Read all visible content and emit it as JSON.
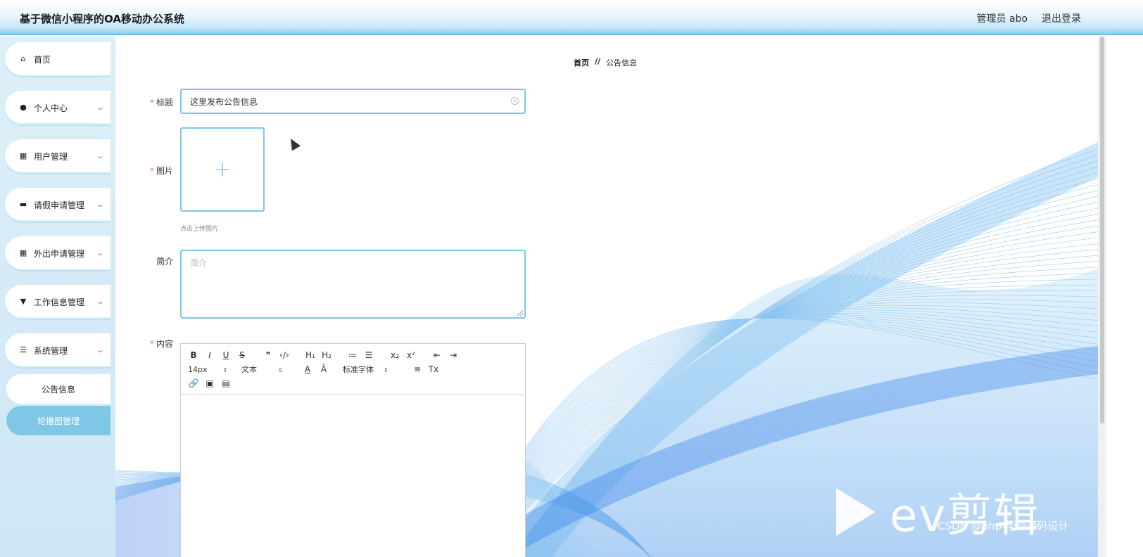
{
  "header": {
    "app_title": "基于微信小程序的OA移动办公系统",
    "admin_label": "管理员 abo",
    "logout_label": "退出登录"
  },
  "sidebar": {
    "items": [
      {
        "label": "首页",
        "icon": "home-icon",
        "has_submenu": false
      },
      {
        "label": "个人中心",
        "icon": "user-icon",
        "has_submenu": true
      },
      {
        "label": "用户管理",
        "icon": "grid-icon",
        "has_submenu": true
      },
      {
        "label": "请假申请管理",
        "icon": "ticket-icon",
        "has_submenu": true
      },
      {
        "label": "外出申请管理",
        "icon": "grid-icon",
        "has_submenu": true
      },
      {
        "label": "工作信息管理",
        "icon": "pin-icon",
        "has_submenu": true
      },
      {
        "label": "系统管理",
        "icon": "list-icon",
        "has_submenu": true
      }
    ],
    "sub_items": [
      {
        "label": "公告信息",
        "active": false
      },
      {
        "label": "轮播图管理",
        "active": true
      }
    ]
  },
  "breadcrumb": {
    "home": "首页",
    "separator": "//",
    "current": "公告信息"
  },
  "form": {
    "title_label": "标题",
    "title_value": "这里发布公告信息",
    "image_label": "图片",
    "upload_hint": "点击上传图片",
    "intro_label": "简介",
    "intro_placeholder": "简介",
    "content_label": "内容"
  },
  "editor": {
    "font_size": "14px",
    "block_type": "文本",
    "font_family": "标准字体",
    "row1": [
      "B",
      "I",
      "U",
      "S",
      "❞",
      "‹/›",
      "H₁",
      "H₂",
      "≔",
      "☰",
      "x₂",
      "x²",
      "⇤",
      "⇥"
    ],
    "row2_icons": [
      "A",
      "Â",
      "≡",
      "Tx"
    ],
    "row3": [
      "🔗",
      "▣",
      "▤"
    ]
  },
  "watermark": {
    "brand": "ev剪辑",
    "credit": "CSDN @php-毕业源码设计"
  },
  "colors": {
    "accent": "#7ec7e6",
    "required": "#f56c6c",
    "header_border": "#6fc0e6"
  }
}
